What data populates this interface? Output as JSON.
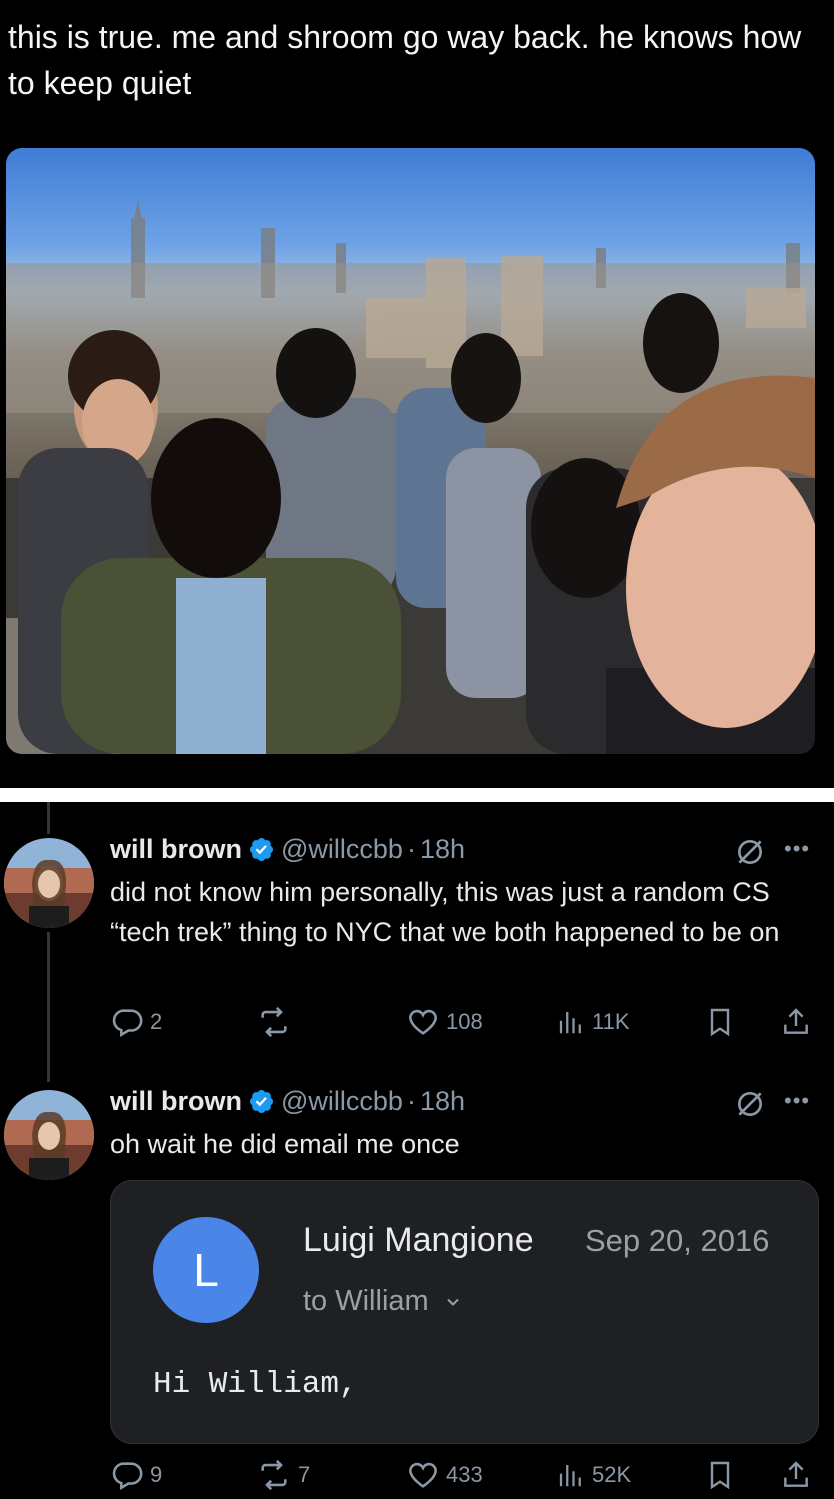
{
  "top_tweet": {
    "text": "this is true. me and shroom go way back. he knows how to keep quiet"
  },
  "replies": [
    {
      "name": "will brown",
      "handle": "@willccbb",
      "time": "18h",
      "text": "did not know him personally, this was just a random CS “tech trek” thing to NYC that we both happened to be on",
      "stats": {
        "replies": "2",
        "reposts": "",
        "likes": "108",
        "views": "11K"
      }
    },
    {
      "name": "will brown",
      "handle": "@willccbb",
      "time": "18h",
      "text": "oh wait he did email me once",
      "stats": {
        "replies": "9",
        "reposts": "7",
        "likes": "433",
        "views": "52K"
      }
    }
  ],
  "email": {
    "avatar_letter": "L",
    "from": "Luigi Mangione",
    "date": "Sep 20, 2016",
    "to": "to William",
    "body": "Hi William,"
  },
  "separator": "·",
  "colors": {
    "background": "#000000",
    "text": "#e7e9ea",
    "muted": "#8b98a5",
    "verified": "#1d9bf0",
    "email_avatar": "#4a86e8",
    "email_card": "#1f2023"
  },
  "icons": [
    "reply-icon",
    "repost-icon",
    "like-icon",
    "views-icon",
    "bookmark-icon",
    "share-icon",
    "grok-icon",
    "more-icon",
    "verified-badge-icon",
    "chevron-down-icon"
  ]
}
